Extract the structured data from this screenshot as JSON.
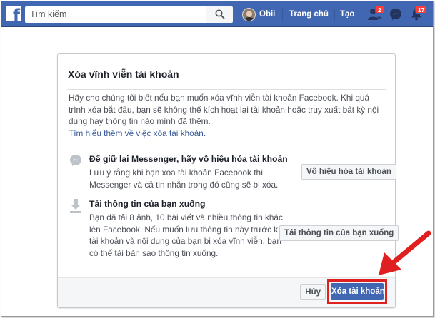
{
  "topbar": {
    "logo_letter": "f",
    "search_placeholder": "Tìm kiếm",
    "user_name": "Obii",
    "home_label": "Trang chủ",
    "create_label": "Tạo",
    "friend_requests_badge": "2",
    "notifications_badge": "17",
    "icons": [
      "search-icon",
      "friends-icon",
      "messenger-icon",
      "notifications-icon"
    ]
  },
  "dialog": {
    "title": "Xóa vĩnh viễn tài khoản",
    "intro": "Hãy cho chúng tôi biết nếu bạn muốn xóa vĩnh viễn tài khoản Facebook. Khi quá trình xóa bắt đầu, bạn sẽ không thể kích hoạt lại tài khoản hoặc truy xuất bất kỳ nội dung hay thông tin nào mình đã thêm.",
    "learn_more_link": "Tìm hiểu thêm về việc xóa tài khoản.",
    "messenger_section": {
      "title": "Để giữ lại Messenger, hãy vô hiệu hóa tài khoản",
      "body": "Lưu ý rằng khi bạn xóa tài khoản Facebook thì Messenger và cả tin nhắn trong đó cũng sẽ bị xóa.",
      "button": "Vô hiệu hóa tài khoản"
    },
    "download_section": {
      "title": "Tải thông tin của bạn xuống",
      "body": "Bạn đã tải 8 ảnh, 10 bài viết và nhiều thông tin khác lên Facebook. Nếu muốn lưu thông tin này trước khi tài khoản và nội dung của bạn bị xóa vĩnh viễn, bạn có thể tải bản sao thông tin xuống.",
      "button": "Tải thông tin của bạn xuống"
    },
    "cancel_button": "Hủy",
    "delete_button": "Xóa tài khoản"
  },
  "colors": {
    "brand_blue": "#4267b2",
    "badge_red": "#fa3e3e",
    "highlight_red": "#e02020",
    "link_blue": "#365899"
  }
}
